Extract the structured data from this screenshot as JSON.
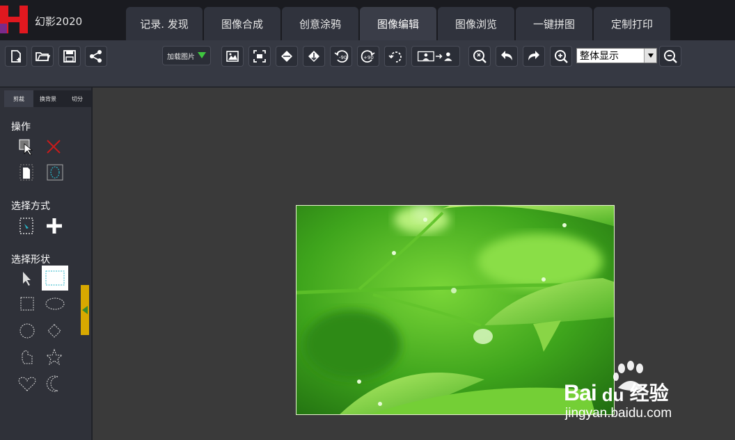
{
  "app": {
    "title": "幻影2020",
    "colors": {
      "logo_red": "#e0181f",
      "logo_purple": "#7a2a8a",
      "accent_gold": "#d8a800"
    }
  },
  "tabs": [
    {
      "label": "记录. 发现",
      "active": false
    },
    {
      "label": "图像合成",
      "active": false
    },
    {
      "label": "创意涂鸦",
      "active": false
    },
    {
      "label": "图像编辑",
      "active": true
    },
    {
      "label": "图像浏览",
      "active": false
    },
    {
      "label": "一键拼图",
      "active": false
    },
    {
      "label": "定制打印",
      "active": false
    }
  ],
  "toolbar": {
    "load_image_label": "加载图片",
    "zoom_value": "整体显示",
    "buttons": [
      "new-file-icon",
      "open-folder-icon",
      "save-icon",
      "share-icon",
      "image-crop-icon",
      "fit-screen-icon",
      "flip-horizontal-icon",
      "flip-vertical-icon",
      "rotate-left-90-icon",
      "rotate-right-90-icon",
      "rotate-free-icon",
      "person-replace-icon",
      "magic-select-icon",
      "undo-icon",
      "redo-icon",
      "zoom-in-icon",
      "zoom-out-icon"
    ]
  },
  "leftpanel": {
    "tabs": [
      {
        "label": "剪裁",
        "active": true
      },
      {
        "label": "换背景",
        "active": false
      },
      {
        "label": "切分",
        "active": false
      }
    ],
    "section_operation": "操作",
    "section_selection_mode": "选择方式",
    "section_selection_shape": "选择形状"
  },
  "watermark": {
    "brand_left": "Bai",
    "brand_right": "du",
    "brand_cn": "经验",
    "url": "jingyan.baidu.com"
  }
}
